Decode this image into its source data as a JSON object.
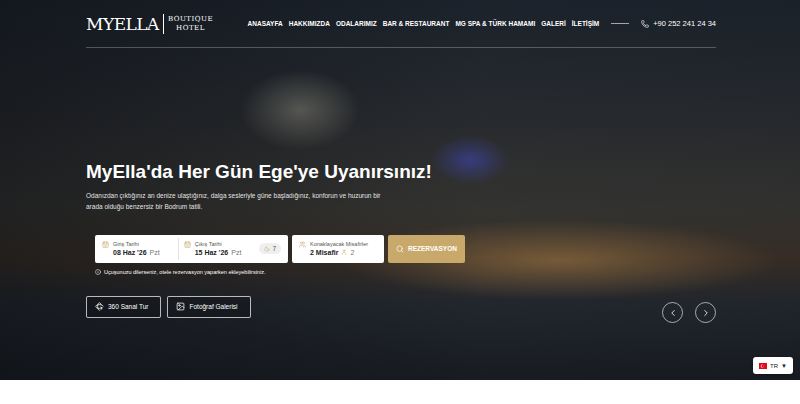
{
  "header": {
    "logo": {
      "name": "MYELLA",
      "sub": [
        "BOUTIQUE",
        "HOTEL"
      ]
    },
    "nav": [
      {
        "label": "ANASAYFA",
        "selected": false
      },
      {
        "label": "HAKKIMIZDA",
        "selected": false
      },
      {
        "label": "ODALARIMIZ",
        "selected": false
      },
      {
        "label": "BAR & RESTAURANT",
        "selected": false
      },
      {
        "label": "MG SPA & TÜRK HAMAMI",
        "selected": false
      },
      {
        "label": "GALERİ",
        "selected": false
      },
      {
        "label": "İLETİŞİM",
        "selected": false
      }
    ],
    "phone": "+90 252 241 24 34"
  },
  "hero": {
    "title": "MyElla'da Her Gün Ege'ye Uyanırsınız!",
    "subtitle": "Odanızdan çıktığınız an denize ulaştığınız, dalga sesleriyle güne başladığınız, konforun ve huzurun bir arada olduğu benzersiz bir Bodrum tatili."
  },
  "booking": {
    "checkin": {
      "label": "Giriş Tarihi",
      "value": "08 Haz '26",
      "day": "Pzt"
    },
    "checkout": {
      "label": "Çıkış Tarihi",
      "value": "15 Haz '26",
      "day": "Pzt"
    },
    "nights": "7",
    "guests": {
      "label": "Konaklayacak Misafirler",
      "value": "2 Misafir",
      "count": "2"
    },
    "button": "REZERVASYON",
    "note": "Uçuşunuzu dilerseniz, otele rezervasyon yaparken ekleyebilirsiniz."
  },
  "actions": [
    {
      "label": "360 Sanal Tur",
      "kind": "tour"
    },
    {
      "label": "Fotoğraf Galerisi",
      "kind": "gallery"
    }
  ],
  "language": {
    "code": "TR",
    "caret": "▼"
  }
}
